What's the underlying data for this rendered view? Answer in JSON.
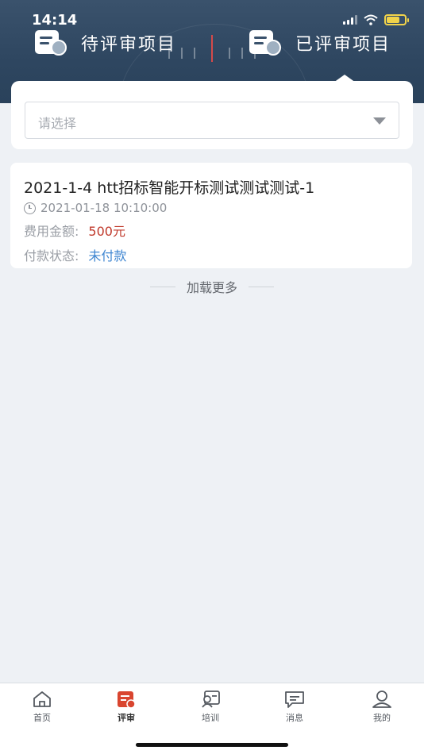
{
  "status_bar": {
    "time": "14:14"
  },
  "header": {
    "tabs": [
      {
        "label": "待评审项目",
        "icon": "pending-review-icon"
      },
      {
        "label": "已评审项目",
        "icon": "reviewed-icon"
      }
    ],
    "active_tab": 1
  },
  "filter": {
    "placeholder": "请选择"
  },
  "projects": [
    {
      "title": "2021-1-4 htt招标智能开标测试测试测试-1",
      "datetime": "2021-01-18 10:10:00",
      "fee_label": "费用金额:",
      "fee_value": "500元",
      "payment_label": "付款状态:",
      "payment_value": "未付款"
    }
  ],
  "load_more": "加载更多",
  "bottom_nav": [
    {
      "label": "首页",
      "icon": "home-icon"
    },
    {
      "label": "评审",
      "icon": "review-icon"
    },
    {
      "label": "培训",
      "icon": "training-icon"
    },
    {
      "label": "消息",
      "icon": "message-icon"
    },
    {
      "label": "我的",
      "icon": "profile-icon"
    }
  ],
  "active_nav": 1,
  "colors": {
    "header_bg": "#2e4660",
    "amount": "#c0392b",
    "unpaid": "#3f86d1",
    "active_nav_icon": "#d9452f"
  }
}
